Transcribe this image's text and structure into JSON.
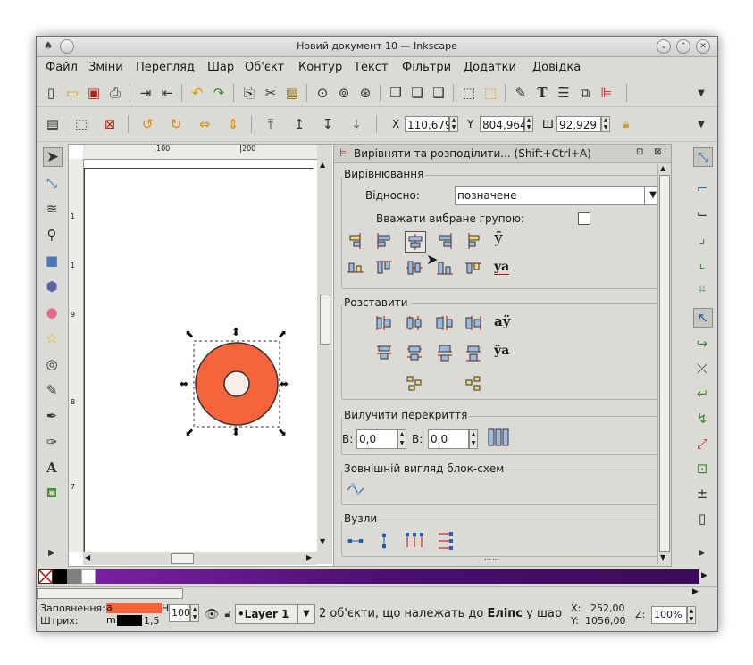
{
  "window": {
    "title": "Новий документ 10 — Inkscape"
  },
  "menu": [
    "Файл",
    "Зміни",
    "Перегляд",
    "Шар",
    "Об'єкт",
    "Контур",
    "Текст",
    "Фільтри",
    "Додатки",
    "Довідка"
  ],
  "select_toolbar": {
    "x_label": "X",
    "x_value": "110,679",
    "y_label": "Y",
    "y_value": "804,964",
    "w_label": "Ш",
    "w_value": "92,929"
  },
  "ruler": {
    "h_ticks": [
      "100",
      "200"
    ],
    "v_ticks": [
      "1",
      "1",
      "9",
      "8",
      "7"
    ]
  },
  "dock": {
    "title": "Вирівняти та розподілити... (Shift+Ctrl+A)",
    "align": {
      "heading": "Вирівнювання",
      "relative_label": "Відносно:",
      "relative_value": "позначене",
      "group_label": "Вважати вибране групою:",
      "row1_glyph": "ӯ",
      "row2_glyph": "ya"
    },
    "distribute": {
      "heading": "Розставити",
      "row1_glyph": "aÿ",
      "row2_glyph": "ÿa"
    },
    "overlap": {
      "heading": "Вилучити перекриття",
      "h_label": "В:",
      "h_value": "0,0",
      "v_label": "В:",
      "v_value": "0,0"
    },
    "graph": {
      "heading": "Зовнішній вигляд блок-схем"
    },
    "nodes": {
      "heading": "Вузли"
    }
  },
  "status": {
    "fill_label": "Заповнення:",
    "fill_value": "a",
    "stroke_label": "Штрих:",
    "stroke_value": "m",
    "stroke_width": "1,5",
    "h_label": "H",
    "opacity": "100",
    "layer": "•Layer 1",
    "message_pre": "2 об'єкти, що належать до ",
    "message_bold": "Еліпс",
    "message_post": " у шар",
    "x_label": "X:",
    "x_coord": "252,00",
    "y_label": "Y:",
    "y_coord": "1056,00",
    "zoom_label": "Z:",
    "zoom": "100%"
  },
  "colors": {
    "fill": "#f5643a",
    "inner": "#f7ece6",
    "accent": "#4a0f6f"
  }
}
